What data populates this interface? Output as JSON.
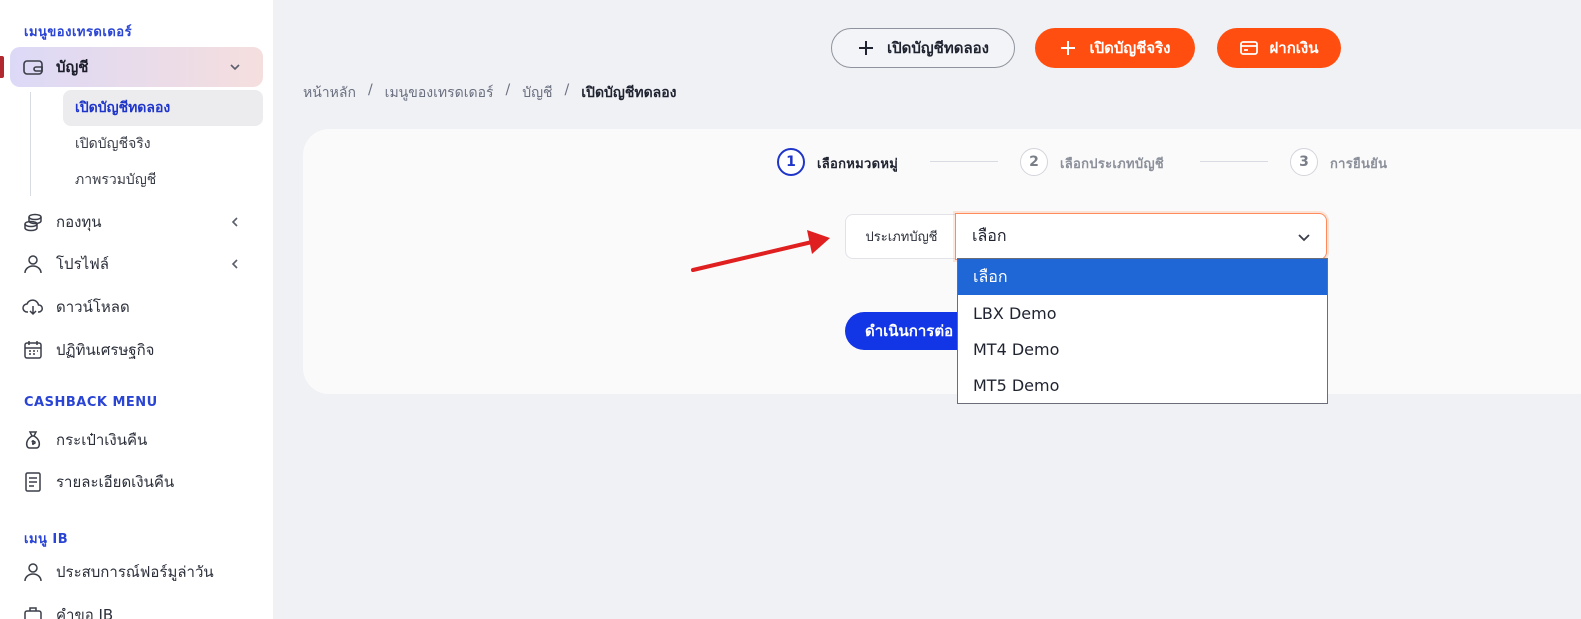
{
  "sidebar": {
    "trader_menu_title": "เมนูของเทรดเดอร์",
    "account": "บัญชี",
    "sub_items": [
      "เปิดบัญชีทดลอง",
      "เปิดบัญชีจริง",
      "ภาพรวมบัญชี"
    ],
    "funds": "กองทุน",
    "profile": "โปรไฟล์",
    "download": "ดาวน์โหลด",
    "calendar": "ปฏิทินเศรษฐกิจ",
    "cashback_title": "CASHBACK MENU",
    "cashback_wallet": "กระเป๋าเงินคืน",
    "cashback_details": "รายละเอียดเงินคืน",
    "ib_title": "เมนู IB",
    "ib_experience": "ประสบการณ์ฟอร์มูล่าวัน",
    "ib_request": "คำขอ IB"
  },
  "header": {
    "open_demo": "เปิดบัญชีทดลอง",
    "open_real": "เปิดบัญชีจริง",
    "deposit": "ฝากเงิน"
  },
  "breadcrumb": [
    "หน้าหลัก",
    "เมนูของเทรดเดอร์",
    "บัญชี",
    "เปิดบัญชีทดลอง"
  ],
  "steps": [
    {
      "num": "1",
      "label": "เลือกหมวดหมู่"
    },
    {
      "num": "2",
      "label": "เลือกประเภทบัญชี"
    },
    {
      "num": "3",
      "label": "การยืนยัน"
    }
  ],
  "form": {
    "label": "ประเภทบัญชี",
    "selected": "เลือก",
    "options": [
      "เลือก",
      "LBX Demo",
      "MT4 Demo",
      "MT5 Demo"
    ],
    "continue": "ดำเนินการต่อ"
  },
  "colors": {
    "accent_blue": "#1236e6",
    "accent_orange": "#ff4e0f",
    "arrow_red": "#e02020"
  }
}
